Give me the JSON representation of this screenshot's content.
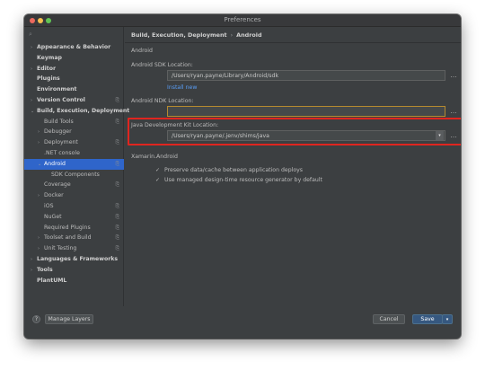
{
  "window": {
    "title": "Preferences"
  },
  "sidebar": {
    "search_icon": "search-icon",
    "items": [
      {
        "label": "Appearance & Behavior",
        "arrow": "›",
        "bold": true
      },
      {
        "label": "Keymap",
        "arrow": "",
        "bold": true
      },
      {
        "label": "Editor",
        "arrow": "›",
        "bold": true
      },
      {
        "label": "Plugins",
        "arrow": "",
        "bold": true
      },
      {
        "label": "Environment",
        "arrow": "",
        "bold": true
      },
      {
        "label": "Version Control",
        "arrow": "›",
        "bold": true,
        "mark": "⎘"
      },
      {
        "label": "Build, Execution, Deployment",
        "arrow": "⌄",
        "bold": true
      },
      {
        "label": "Build Tools",
        "arrow": "",
        "mark": "⎘"
      },
      {
        "label": "Debugger",
        "arrow": "›"
      },
      {
        "label": "Deployment",
        "arrow": "›",
        "mark": "⎘"
      },
      {
        "label": ".NET console",
        "arrow": ""
      },
      {
        "label": "Android",
        "arrow": "⌄",
        "mark": "⎘",
        "selected": true
      },
      {
        "label": "SDK Components",
        "arrow": ""
      },
      {
        "label": "Coverage",
        "arrow": "",
        "mark": "⎘"
      },
      {
        "label": "Docker",
        "arrow": "›"
      },
      {
        "label": "iOS",
        "arrow": "",
        "mark": "⎘"
      },
      {
        "label": "NuGet",
        "arrow": "",
        "mark": "⎘"
      },
      {
        "label": "Required Plugins",
        "arrow": "",
        "mark": "⎘"
      },
      {
        "label": "Toolset and Build",
        "arrow": "›",
        "mark": "⎘"
      },
      {
        "label": "Unit Testing",
        "arrow": "›",
        "mark": "⎘"
      },
      {
        "label": "Languages & Frameworks",
        "arrow": "›",
        "bold": true
      },
      {
        "label": "Tools",
        "arrow": "›",
        "bold": true
      },
      {
        "label": "PlantUML",
        "arrow": "",
        "bold": true
      }
    ]
  },
  "breadcrumb": {
    "part1": "Build, Execution, Deployment",
    "separator": "›",
    "part2": "Android"
  },
  "android": {
    "section_title": "Android",
    "sdk_label": "Android SDK Location:",
    "sdk_value": "/Users/ryan.payne/Library/Android/sdk",
    "install_link": "Install new",
    "ndk_label": "Android NDK Location:",
    "ndk_value": "",
    "jdk_label": "Java Development Kit Location:",
    "jdk_value": "/Users/ryan.payne/.jenv/shims/java"
  },
  "xamarin": {
    "section_title": "Xamarin.Android",
    "preserve_label": "Preserve data/cache between application deploys",
    "preserve_checked": "✓",
    "managed_label": "Use managed design-time resource generator by default",
    "managed_checked": "✓"
  },
  "icons": {
    "browse": "…",
    "reset": "⟲",
    "dropdown": "▾"
  },
  "footer": {
    "help": "?",
    "manage_layers": "Manage Layers",
    "cancel": "Cancel",
    "save": "Save",
    "save_caret": "▾"
  },
  "colors": {
    "accent": "#2f65ca",
    "highlight_border": "#e0251f",
    "link": "#589df6",
    "focus_border": "#b58a2f"
  }
}
